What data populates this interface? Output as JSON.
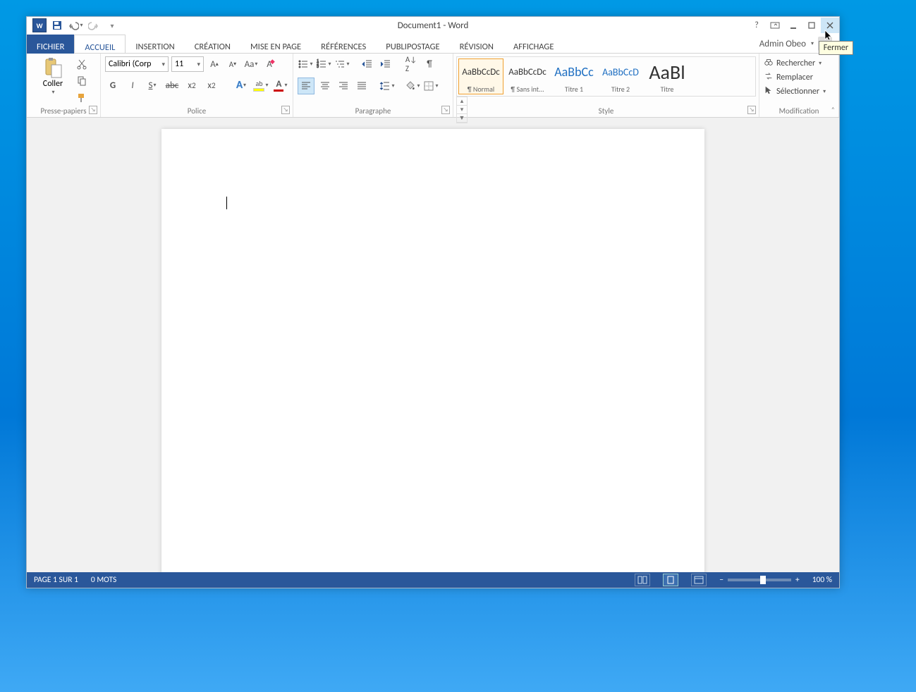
{
  "titlebar": {
    "title": "Document1 - Word",
    "tooltip": "Fermer"
  },
  "tabs": {
    "file": "FICHIER",
    "items": [
      "ACCUEIL",
      "INSERTION",
      "CRÉATION",
      "MISE EN PAGE",
      "RÉFÉRENCES",
      "PUBLIPOSTAGE",
      "RÉVISION",
      "AFFICHAGE"
    ],
    "active": "ACCUEIL",
    "user": "Admin Obeo"
  },
  "ribbon": {
    "clipboard": {
      "label": "Presse-papiers",
      "paste": "Coller"
    },
    "font": {
      "label": "Police",
      "font_name": "Calibri (Corp",
      "font_size": "11",
      "bold": "G",
      "italic": "I",
      "underline": "S",
      "strike": "abc",
      "sub": "x",
      "sup": "x"
    },
    "paragraph": {
      "label": "Paragraphe"
    },
    "style": {
      "label": "Style",
      "items": [
        {
          "preview": "AaBbCcDc",
          "name": "¶ Normal"
        },
        {
          "preview": "AaBbCcDc",
          "name": "¶ Sans int..."
        },
        {
          "preview": "AaBbCc",
          "name": "Titre 1"
        },
        {
          "preview": "AaBbCcD",
          "name": "Titre 2"
        },
        {
          "preview": "AaBl",
          "name": "Titre"
        }
      ]
    },
    "editing": {
      "label": "Modification",
      "find": "Rechercher",
      "replace": "Remplacer",
      "select": "Sélectionner"
    }
  },
  "status": {
    "page": "PAGE 1 SUR 1",
    "words": "0 MOTS",
    "zoom": "100 %"
  }
}
